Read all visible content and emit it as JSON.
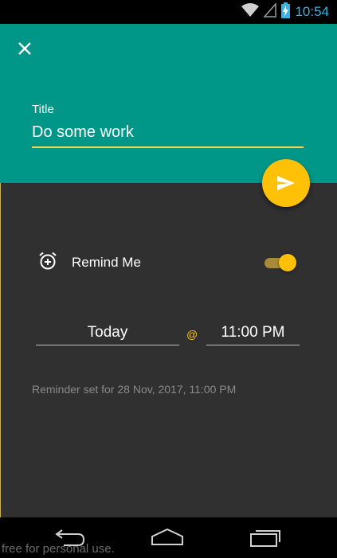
{
  "status_bar": {
    "time": "10:54",
    "icons": [
      "wifi-icon",
      "signal-icon",
      "battery-charging-icon"
    ]
  },
  "header": {
    "close_icon": "close-icon",
    "title_label": "Title",
    "title_value": "Do some work",
    "color": "#009688"
  },
  "fab": {
    "icon": "send-icon",
    "color": "#ffc107"
  },
  "reminder": {
    "icon": "alarm-add-icon",
    "label": "Remind Me",
    "enabled": true,
    "date": "Today",
    "at": "@",
    "time": "11:00 PM",
    "summary": "Reminder set for 28 Nov, 2017, 11:00 PM"
  },
  "nav_bar": {
    "buttons": [
      "back-icon",
      "home-icon",
      "recents-icon"
    ]
  },
  "watermark": "free for personal use."
}
